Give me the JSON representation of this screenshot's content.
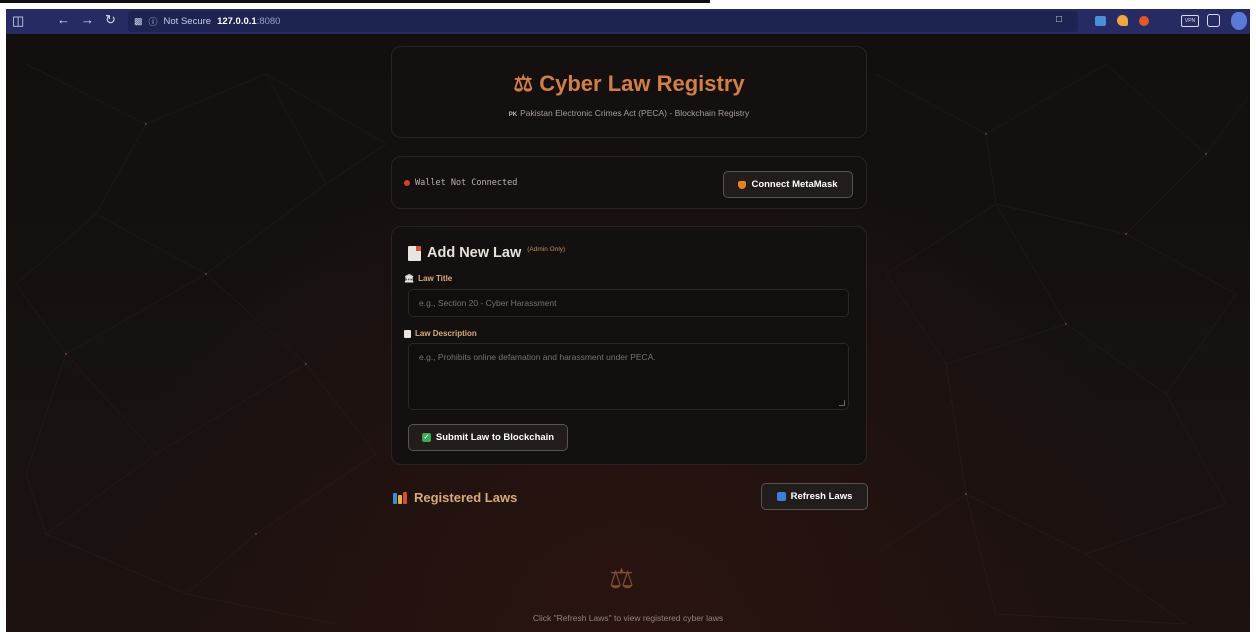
{
  "browser": {
    "security_label": "Not Secure",
    "host": "127.0.0.1",
    "port": ":8080"
  },
  "header": {
    "title": "Cyber Law Registry",
    "flag": "PK",
    "subtitle": "Pakistan Electronic Crimes Act (PECA) - Blockchain Registry"
  },
  "wallet": {
    "status": "Wallet Not Connected",
    "connect_label": "Connect MetaMask"
  },
  "form": {
    "title": "Add New Law",
    "admin_note": "(Admin Only)",
    "law_title_label": "Law Title",
    "law_title_placeholder": "e.g., Section 20 - Cyber Harassment",
    "law_desc_label": "Law Description",
    "law_desc_placeholder": "e.g., Prohibits online defamation and harassment under PECA.",
    "submit_label": "Submit Law to Blockchain"
  },
  "registered": {
    "title": "Registered Laws",
    "refresh_label": "Refresh Laws",
    "empty_text": "Click \"Refresh Laws\" to view registered cyber laws"
  },
  "icons": {
    "scales": "scales-icon",
    "fox": "metamask-fox-icon",
    "document": "document-icon",
    "bank": "bank-icon",
    "memo": "memo-icon",
    "check": "check-icon",
    "books": "books-icon",
    "refresh": "refresh-icon"
  },
  "colors": {
    "accent": "#d27f45",
    "label": "#d7ab78",
    "browser_bar": "#262c63",
    "status_red": "#d93c32"
  }
}
